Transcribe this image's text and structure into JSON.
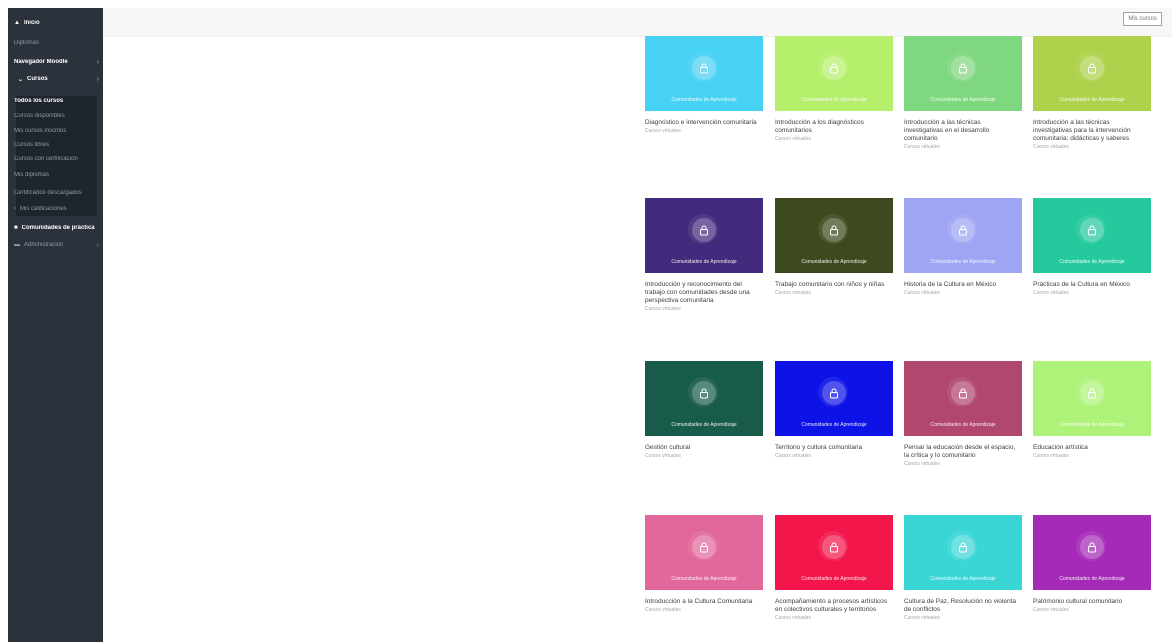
{
  "sidebar": {
    "home": "Inicio",
    "items": [
      {
        "label": "Diplomas",
        "kind": "dim"
      },
      {
        "label": "Navegador Moodle",
        "kind": "bold"
      },
      {
        "label": "Cursos",
        "kind": "bold"
      },
      {
        "label": "Todos los cursos",
        "kind": "bold"
      },
      {
        "label": "Cursos disponibles",
        "kind": "dim"
      },
      {
        "label": "Mis cursos inscritos",
        "kind": "dim"
      },
      {
        "label": "Cursos libres",
        "kind": "dim"
      },
      {
        "label": "Cursos con certificación",
        "kind": "dim"
      },
      {
        "label": "Mis diplomas",
        "kind": "dim"
      },
      {
        "label": "Certificados descargados",
        "kind": "dim"
      },
      {
        "label": "Mis calificaciones",
        "kind": "dim"
      }
    ],
    "footer_items": [
      "Comunidades de práctica",
      "Administración"
    ]
  },
  "topbar": {
    "button": "Mis cursos"
  },
  "cards": [
    {
      "color": "#47d1f2",
      "label": "Comunidades de Aprendizaje",
      "title": "Diagnóstico e intervención comunitaria",
      "sub": "Cursos virtuales"
    },
    {
      "color": "#b6ef6b",
      "label": "Comunidades de Aprendizaje",
      "title": "Introducción a los diagnósticos comunitarios",
      "sub": "Cursos virtuales"
    },
    {
      "color": "#7fd77f",
      "label": "Comunidades de Aprendizaje",
      "title": "Introducción a las técnicas investigativas en el desarrollo comunitario",
      "sub": "Cursos virtuales"
    },
    {
      "color": "#aed24c",
      "label": "Comunidades de Aprendizaje",
      "title": "Introducción a las técnicas investigativas para la intervención comunitaria: didácticas y saberes",
      "sub": "Cursos virtuales"
    },
    {
      "color": "#422a7c",
      "label": "Comunidades de Aprendizaje",
      "title": "Introducción y reconocimiento del trabajo con comunidades desde una perspectiva comunitaria",
      "sub": "Cursos virtuales"
    },
    {
      "color": "#3d4a1d",
      "label": "Comunidades de Aprendizaje",
      "title": "Trabajo comunitario con niños y niñas",
      "sub": "Cursos virtuales"
    },
    {
      "color": "#9ea5f2",
      "label": "Comunidades de Aprendizaje",
      "title": "Historia de la Cultura en México",
      "sub": "Cursos virtuales"
    },
    {
      "color": "#25c99e",
      "label": "Comunidades de Aprendizaje",
      "title": "Prácticas de la Cultura en México",
      "sub": "Cursos virtuales"
    },
    {
      "color": "#185b4b",
      "label": "Comunidades de Aprendizaje",
      "title": "Gestión cultural",
      "sub": "Cursos virtuales"
    },
    {
      "color": "#0d12e6",
      "label": "Comunidades de Aprendizaje",
      "title": "Territorio y cultura comunitaria",
      "sub": "Cursos virtuales"
    },
    {
      "color": "#b1466f",
      "label": "Comunidades de Aprendizaje",
      "title": "Pensar la educación desde el espacio, la crítica y lo comunitario",
      "sub": "Cursos virtuales"
    },
    {
      "color": "#aef27a",
      "label": "Comunidades de Aprendizaje",
      "title": "Educación artística",
      "sub": "Cursos virtuales"
    },
    {
      "color": "#e2679a",
      "label": "Comunidades de Aprendizaje",
      "title": "Introducción a la Cultura Comunitaria",
      "sub": "Cursos virtuales"
    },
    {
      "color": "#f3164b",
      "label": "Comunidades de Aprendizaje",
      "title": "Acompañamiento a procesos artísticos en colectivos culturales y territorios",
      "sub": "Cursos virtuales"
    },
    {
      "color": "#3ad6d6",
      "label": "Comunidades de Aprendizaje",
      "title": "Cultura de Paz, Resolución no violenta de conflictos",
      "sub": "Cursos virtuales"
    },
    {
      "color": "#a52ab7",
      "label": "Comunidades de Aprendizaje",
      "title": "Patrimonio cultural comunitario",
      "sub": "Cursos virtuales"
    }
  ]
}
